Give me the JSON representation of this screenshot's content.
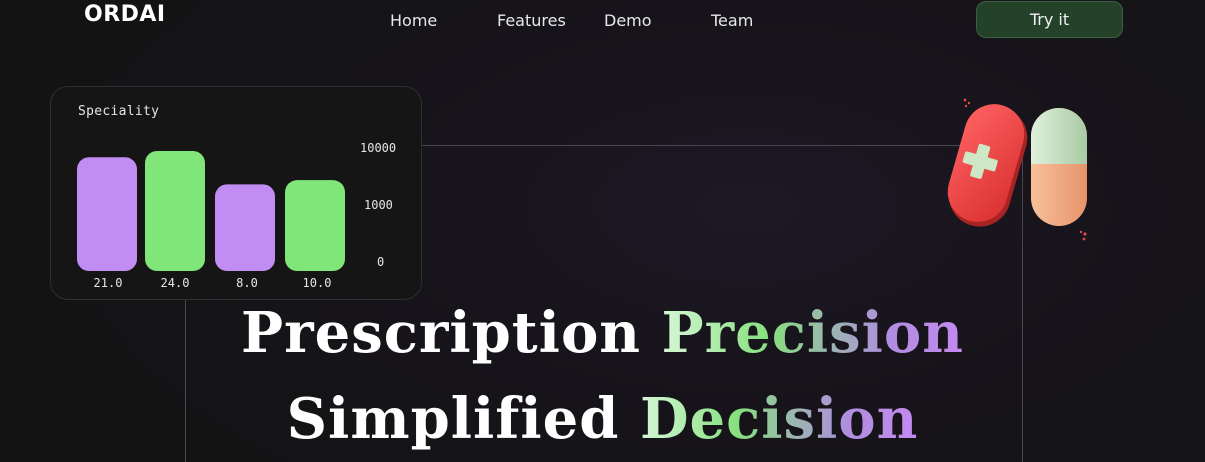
{
  "header": {
    "logo": "ORDAI",
    "nav": [
      "Home",
      "Features",
      "Demo",
      "Team"
    ],
    "cta_label": "Try it"
  },
  "hero": {
    "line1_plain": "Prescription",
    "line1_accent": "Precision",
    "line2_plain": "Simplified",
    "line2_accent": "Decision"
  },
  "chart_data": {
    "type": "bar",
    "title": "Speciality",
    "values": [
      21.0,
      24.0,
      8.0,
      10.0
    ],
    "value_labels": [
      "21.0",
      "24.0",
      "8.0",
      "10.0"
    ],
    "ytick_labels": [
      "10000",
      "1000",
      "0"
    ],
    "bar_colors": [
      "#c28df2",
      "#80e67a",
      "#c28df2",
      "#80e67a"
    ]
  },
  "colors": {
    "accent_green": "#80e67a",
    "accent_purple": "#c28df2",
    "button_bg": "#24412a",
    "pill_red": "#ef4545",
    "pill_peach": "#f2ab84",
    "pill_mint": "#c6e3c4"
  },
  "icons": {
    "pill_illustration": "medicine-capsule-icon"
  }
}
